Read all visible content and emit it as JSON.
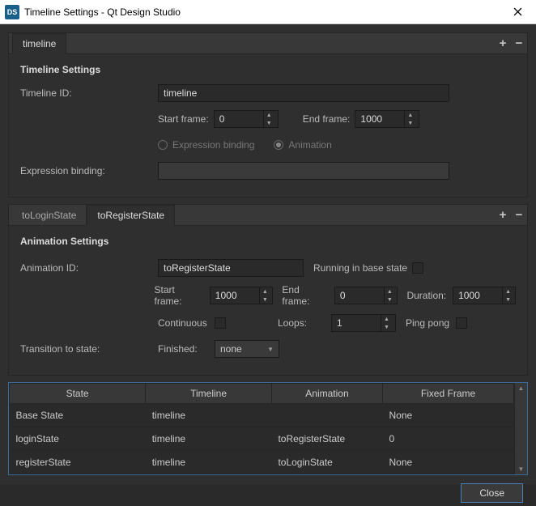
{
  "window": {
    "app_icon_text": "DS",
    "title": "Timeline Settings - Qt Design Studio"
  },
  "timeline": {
    "tab_label": "timeline",
    "section_title": "Timeline Settings",
    "id_label": "Timeline ID:",
    "id_value": "timeline",
    "start_frame_label": "Start frame:",
    "start_frame_value": "0",
    "end_frame_label": "End frame:",
    "end_frame_value": "1000",
    "radio_expression_label": "Expression binding",
    "radio_animation_label": "Animation",
    "expression_binding_label": "Expression binding:",
    "expression_binding_value": ""
  },
  "animation": {
    "tabs": {
      "tab1": "toLoginState",
      "tab2": "toRegisterState"
    },
    "section_title": "Animation Settings",
    "id_label": "Animation ID:",
    "id_value": "toRegisterState",
    "running_label": "Running in base state",
    "start_frame_label": "Start frame:",
    "start_frame_value": "1000",
    "end_frame_label": "End frame:",
    "end_frame_value": "0",
    "duration_label": "Duration:",
    "duration_value": "1000",
    "continuous_label": "Continuous",
    "loops_label": "Loops:",
    "loops_value": "1",
    "pingpong_label": "Ping pong",
    "transition_label": "Transition to state:",
    "finished_label": "Finished:",
    "finished_value": "none"
  },
  "table": {
    "headers": {
      "state": "State",
      "timeline": "Timeline",
      "animation": "Animation",
      "fixed_frame": "Fixed Frame"
    },
    "rows": [
      {
        "state": "Base State",
        "timeline": "timeline",
        "animation": "",
        "fixed_frame": "None"
      },
      {
        "state": "loginState",
        "timeline": "timeline",
        "animation": "toRegisterState",
        "fixed_frame": "0"
      },
      {
        "state": "registerState",
        "timeline": "timeline",
        "animation": "toLoginState",
        "fixed_frame": "None"
      }
    ]
  },
  "footer": {
    "close_label": "Close"
  }
}
